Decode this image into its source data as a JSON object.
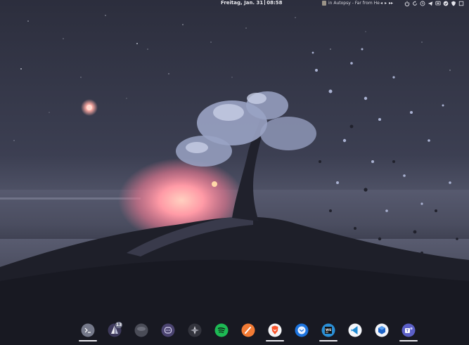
{
  "topbar": {
    "clock_date": "Freitag, Jan. 31",
    "clock_time": "08:58",
    "media_title": "in Autopsy - Far from He",
    "tray_icons": [
      "media-previous-icon",
      "media-play-icon",
      "media-next-icon",
      "power-icon",
      "refresh-icon",
      "clock-icon",
      "telegram-icon",
      "screen-icon",
      "check-icon",
      "shield-icon",
      "window-icon"
    ]
  },
  "dock": {
    "items": [
      {
        "name": "terminal-icon",
        "running": true
      },
      {
        "name": "sailboat-icon",
        "running": false,
        "badge": "13"
      },
      {
        "name": "hat-icon",
        "running": false
      },
      {
        "name": "mastodon-icon",
        "running": false
      },
      {
        "name": "darktable-icon",
        "running": false
      },
      {
        "name": "spotify-icon",
        "running": false
      },
      {
        "name": "paintbrush-icon",
        "running": false
      },
      {
        "name": "brave-icon",
        "running": true
      },
      {
        "name": "thunderbird-icon",
        "running": false
      },
      {
        "name": "webstorm-icon",
        "running": true
      },
      {
        "name": "vscode-icon",
        "running": false
      },
      {
        "name": "virtualbox-icon",
        "running": false
      },
      {
        "name": "teams-icon",
        "running": true
      }
    ]
  },
  "colors": {
    "sky": "#34364a",
    "sun": "#ff9aa6",
    "tree": "#9aa3c4",
    "hill": "#1e1f29"
  }
}
